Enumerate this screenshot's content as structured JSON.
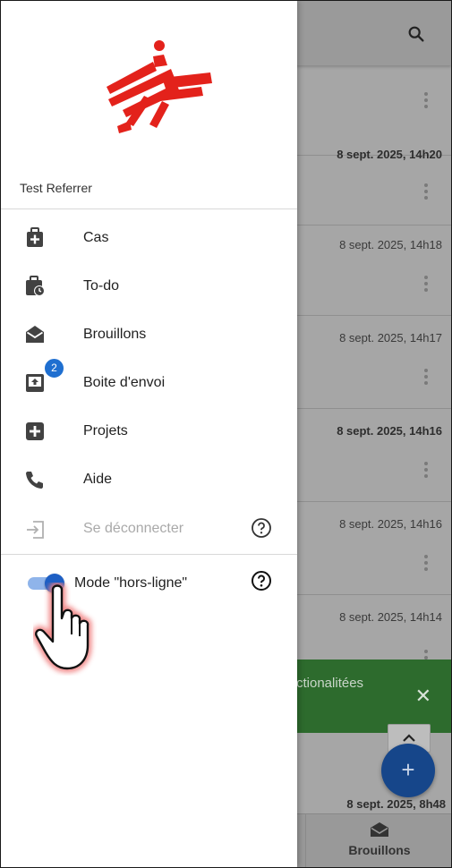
{
  "background": {
    "rows": [
      {
        "date": "",
        "bold": false
      },
      {
        "date": "8 sept. 2025, 14h20",
        "bold": true
      },
      {
        "date": "8 sept. 2025, 14h18",
        "bold": false
      },
      {
        "date": "8 sept. 2025, 14h17",
        "bold": false
      },
      {
        "date": "8 sept. 2025, 14h16",
        "bold": true
      },
      {
        "date": "8 sept. 2025, 14h16",
        "bold": false
      },
      {
        "date": "8 sept. 2025, 14h14",
        "bold": false
      }
    ],
    "snackbar_text": "ctionalitées",
    "snackbar_close": "✕",
    "fab_label": "+",
    "last_date": "8 sept. 2025, 8h48",
    "bottom_tab_label": "Brouillons"
  },
  "drawer": {
    "user_name": "Test Referrer",
    "menu": [
      {
        "label": "Cas",
        "icon": "medkit-icon"
      },
      {
        "label": "To-do",
        "icon": "briefcase-clock-icon"
      },
      {
        "label": "Brouillons",
        "icon": "envelope-open-icon"
      },
      {
        "label": "Boite d'envoi",
        "icon": "outbox-icon",
        "badge": "2"
      },
      {
        "label": "Projets",
        "icon": "plus-square-icon"
      },
      {
        "label": "Aide",
        "icon": "phone-icon"
      }
    ],
    "logout_label": "Se déconnecter",
    "offline_mode_label": "Mode \"hors-ligne\"",
    "offline_mode_enabled": true
  },
  "colors": {
    "logo_red": "#e3221b",
    "accent_blue": "#1e5fc4",
    "badge_blue": "#1f6fd0",
    "snackbar_green": "#2d6b2d"
  }
}
